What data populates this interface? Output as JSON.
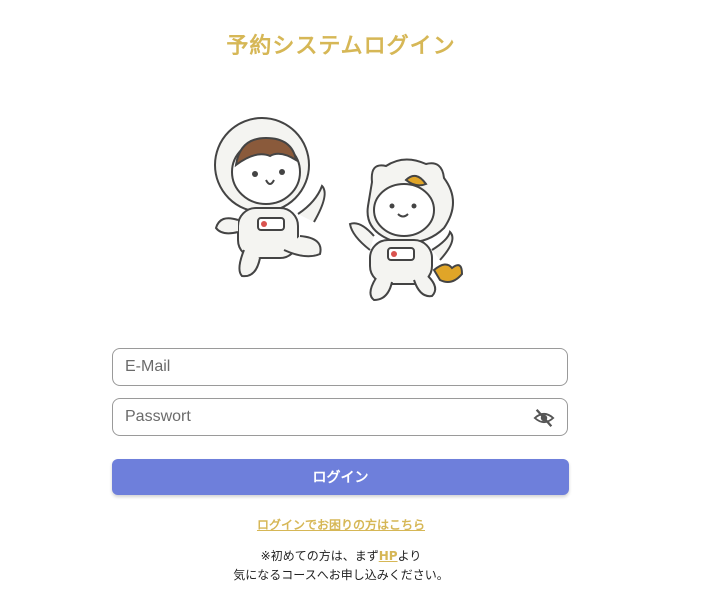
{
  "page": {
    "title": "予約システムログイン"
  },
  "illustration": {
    "name": "astronaut-boy-and-cat-illustration"
  },
  "form": {
    "email_placeholder": "E-Mail",
    "password_placeholder": "Passwort",
    "login_label": "ログイン"
  },
  "help": {
    "link_label": "ログインでお困りの方はこちら"
  },
  "note": {
    "line1_prefix": "※初めての方は、まず",
    "line1_link": "HP",
    "line1_suffix": "より",
    "line2": "気になるコースへお申し込みください。"
  },
  "colors": {
    "accent_gold": "#d6b756",
    "button_blue": "#6e7fdb"
  },
  "icons": {
    "password_toggle": "eye-off-icon"
  }
}
